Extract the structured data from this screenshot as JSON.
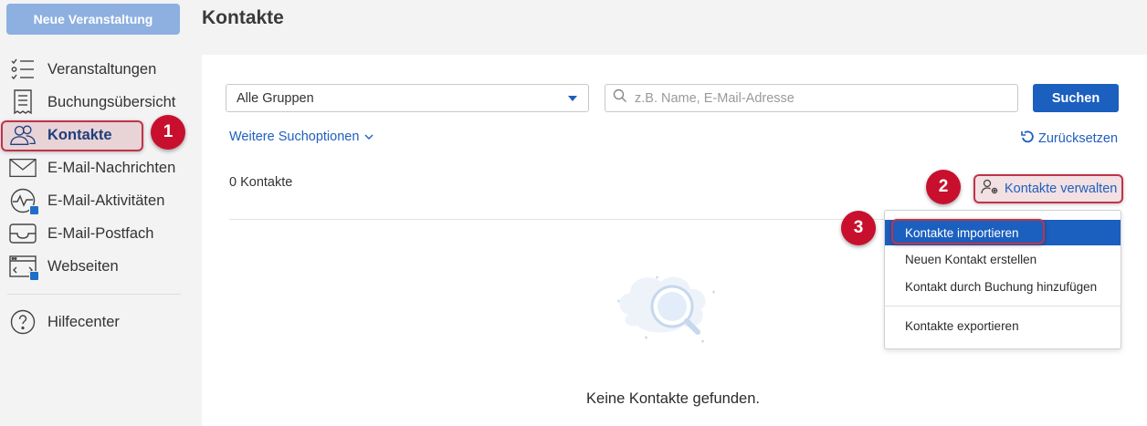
{
  "header": {
    "new_event_label": "Neue Veranstaltung",
    "page_title": "Kontakte"
  },
  "sidebar": {
    "items": [
      {
        "label": "Veranstaltungen",
        "icon": "checklist-icon"
      },
      {
        "label": "Buchungsübersicht",
        "icon": "receipt-icon"
      },
      {
        "label": "Kontakte",
        "icon": "people-icon"
      },
      {
        "label": "E-Mail-Nachrichten",
        "icon": "envelope-icon"
      },
      {
        "label": "E-Mail-Aktivitäten",
        "icon": "activity-icon"
      },
      {
        "label": "E-Mail-Postfach",
        "icon": "inbox-icon"
      },
      {
        "label": "Webseiten",
        "icon": "browser-icon"
      }
    ],
    "help_label": "Hilfecenter"
  },
  "filters": {
    "group_selected": "Alle Gruppen",
    "search_placeholder": "z.B. Name, E-Mail-Adresse",
    "search_button": "Suchen",
    "more_options": "Weitere Suchoptionen",
    "reset": "Zurücksetzen"
  },
  "results": {
    "count_label": "0 Kontakte",
    "empty_message": "Keine Kontakte gefunden."
  },
  "manage": {
    "button_label": "Kontakte verwalten",
    "menu": [
      "Kontakte importieren",
      "Neuen Kontakt erstellen",
      "Kontakt durch Buchung hinzufügen",
      "Kontakte exportieren"
    ]
  },
  "annotations": {
    "badge1": "1",
    "badge2": "2",
    "badge3": "3"
  },
  "colors": {
    "accent": "#1b5fbf",
    "highlight": "#c0334a",
    "badge": "#c8102e"
  }
}
